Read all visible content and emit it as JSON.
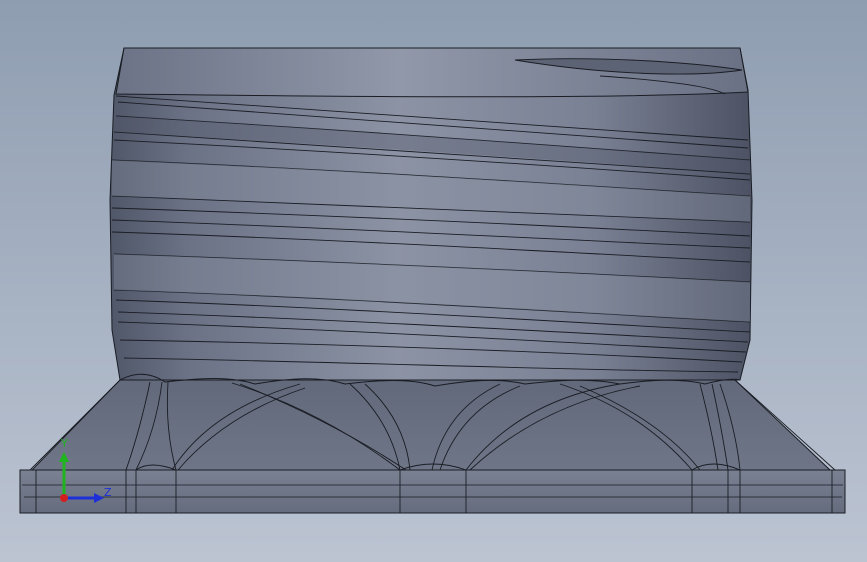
{
  "viewport": {
    "background_top": "#8f9db1",
    "background_bottom": "#bcc4d2"
  },
  "model": {
    "name": "threaded-cylinder-on-ribbed-base",
    "body_color": "#6f7688",
    "edge_color": "#1a1d24",
    "thread_count": 4
  },
  "triad": {
    "y_label": "Y",
    "z_label": "Z",
    "y_color": "#1fb51f",
    "z_color": "#1f2fd8",
    "x_color": "#d22020"
  }
}
